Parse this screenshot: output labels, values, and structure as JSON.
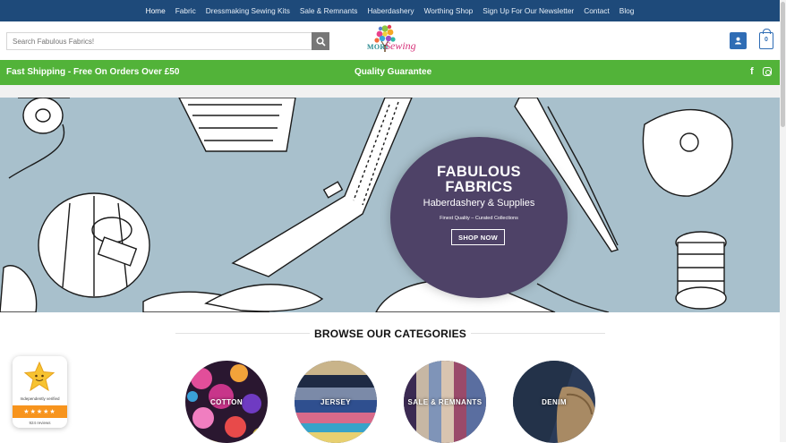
{
  "nav": {
    "items": [
      "Home",
      "Fabric",
      "Dressmaking Sewing Kits",
      "Sale & Remnants",
      "Haberdashery",
      "Worthing Shop",
      "Sign Up For Our Newsletter",
      "Contact",
      "Blog"
    ]
  },
  "header": {
    "search_placeholder": "Search Fabulous Fabrics!",
    "logo_mori": "MORI",
    "logo_sewing": "Sewing",
    "cart_count": "0"
  },
  "promo": {
    "left": "Fast Shipping - Free On Orders Over £50",
    "middle": "Quality Guarantee",
    "facebook": "f"
  },
  "hero": {
    "title_line1": "FABULOUS",
    "title_line2": "FABRICS",
    "subtitle": "Haberdashery & Supplies",
    "small": "Finest Quality – Curated Collections",
    "button": "SHOP NOW"
  },
  "categories": {
    "title": "BROWSE OUR CATEGORIES",
    "items": [
      "COTTON",
      "JERSEY",
      "SALE & REMNANTS",
      "DENIM"
    ]
  },
  "badge": {
    "verified": "Independently verified",
    "stars": "★★★★★",
    "reviews": "924 reviews"
  },
  "colors": {
    "nav_bg": "#1e4a7a",
    "promo_bg": "#52b339",
    "hero_bg": "#a8c0cc",
    "hero_circle": "#4e4267",
    "accent_blue": "#2f6db5",
    "badge_orange": "#f7941d"
  }
}
